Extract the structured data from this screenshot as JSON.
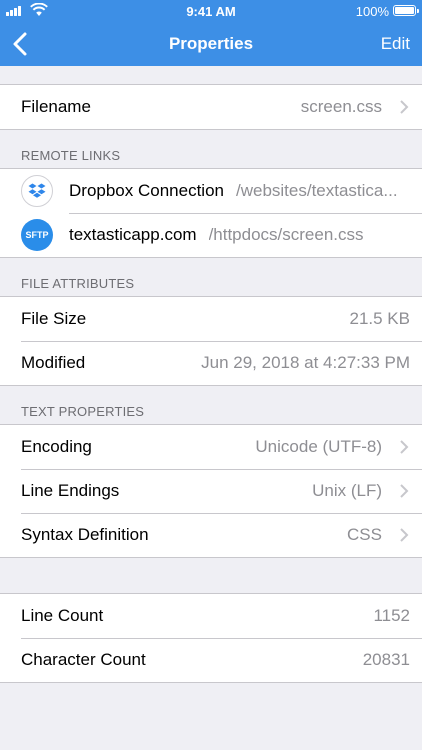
{
  "status_bar": {
    "time": "9:41 AM",
    "battery": "100%"
  },
  "nav": {
    "title": "Properties",
    "edit_label": "Edit",
    "back_icon": "chevron-left-icon"
  },
  "file": {
    "label": "Filename",
    "value": "screen.css"
  },
  "remote_links": {
    "header": "REMOTE LINKS",
    "items": [
      {
        "name": "Dropbox Connection",
        "path": "/websites/textastica...",
        "icon": "dropbox-icon"
      },
      {
        "name": "textasticapp.com",
        "path": "/httpdocs/screen.css",
        "icon": "SFTP"
      }
    ]
  },
  "file_attributes": {
    "header": "FILE ATTRIBUTES",
    "items": [
      {
        "label": "File Size",
        "value": "21.5 KB"
      },
      {
        "label": "Modified",
        "value": "Jun 29, 2018 at 4:27:33 PM"
      }
    ]
  },
  "text_properties": {
    "header": "TEXT PROPERTIES",
    "items": [
      {
        "label": "Encoding",
        "value": "Unicode (UTF-8)"
      },
      {
        "label": "Line Endings",
        "value": "Unix (LF)"
      },
      {
        "label": "Syntax Definition",
        "value": "CSS"
      }
    ]
  },
  "counts": {
    "items": [
      {
        "label": "Line Count",
        "value": "1152"
      },
      {
        "label": "Character Count",
        "value": "20831"
      }
    ]
  },
  "colors": {
    "accent": "#3d8fe6",
    "background": "#efeff4",
    "secondary_text": "#8e8e93"
  }
}
